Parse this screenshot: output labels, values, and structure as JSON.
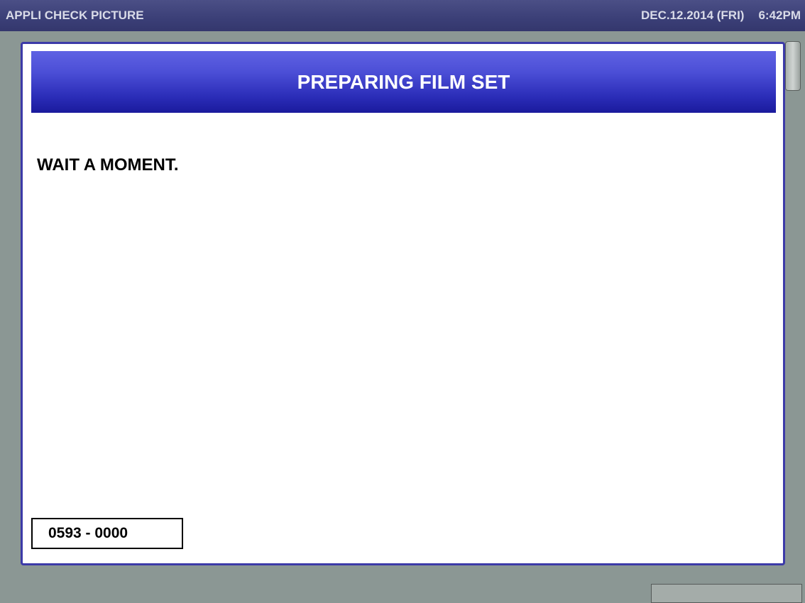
{
  "titlebar": {
    "app_name": "APPLI CHECK PICTURE",
    "date": "DEC.12.2014 (FRI)",
    "time": "6:42PM"
  },
  "dialog": {
    "title": "PREPARING FILM SET",
    "message": "WAIT A MOMENT.",
    "code": "0593 - 0000"
  },
  "colors": {
    "background": "#8b9794",
    "titlebar": "#3b3f77",
    "dialog_border": "#3c3aa8",
    "header_top": "#5f62e3",
    "header_bottom": "#1a1a9c"
  }
}
